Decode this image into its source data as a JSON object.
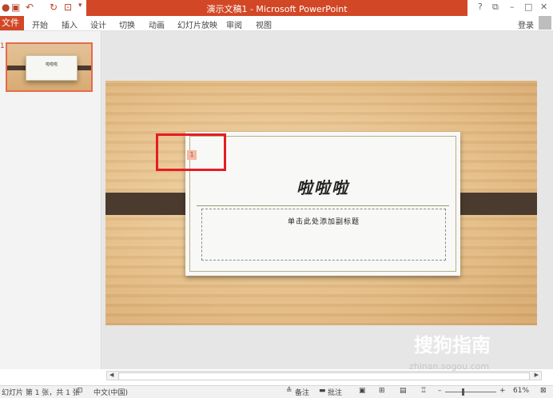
{
  "titlebar": {
    "title": "演示文稿1 - Microsoft PowerPoint",
    "qat_icons": [
      "powerpoint-logo-icon",
      "save-icon",
      "undo-icon",
      "redo-icon",
      "start-from-beginning-icon",
      "customize-qat-icon"
    ],
    "window_buttons": {
      "help": "?",
      "restore_ribbon": "⧉",
      "minimize": "–",
      "maximize": "□",
      "close": "✕"
    }
  },
  "ribbon": {
    "file_tab": "文件",
    "tabs": [
      "开始",
      "插入",
      "设计",
      "切换",
      "动画",
      "幻灯片放映",
      "审阅",
      "视图"
    ],
    "login": "登录"
  },
  "thumbnails": [
    {
      "number": "1",
      "title": "啦啦啦"
    }
  ],
  "slide": {
    "title": "啦啦啦",
    "subtitle_placeholder": "单击此处添加副标题",
    "slide_number_tag": "1"
  },
  "statusbar": {
    "slide_info": "幻灯片 第 1 张，共 1 张",
    "language": "中文(中国)",
    "notes": "备注",
    "comments": "批注",
    "zoom": "61%"
  },
  "watermark": {
    "brand": "搜狗指南",
    "url": "zhinan.sogou.com"
  },
  "colors": {
    "accent": "#d24726",
    "highlight": "#e51c23"
  }
}
